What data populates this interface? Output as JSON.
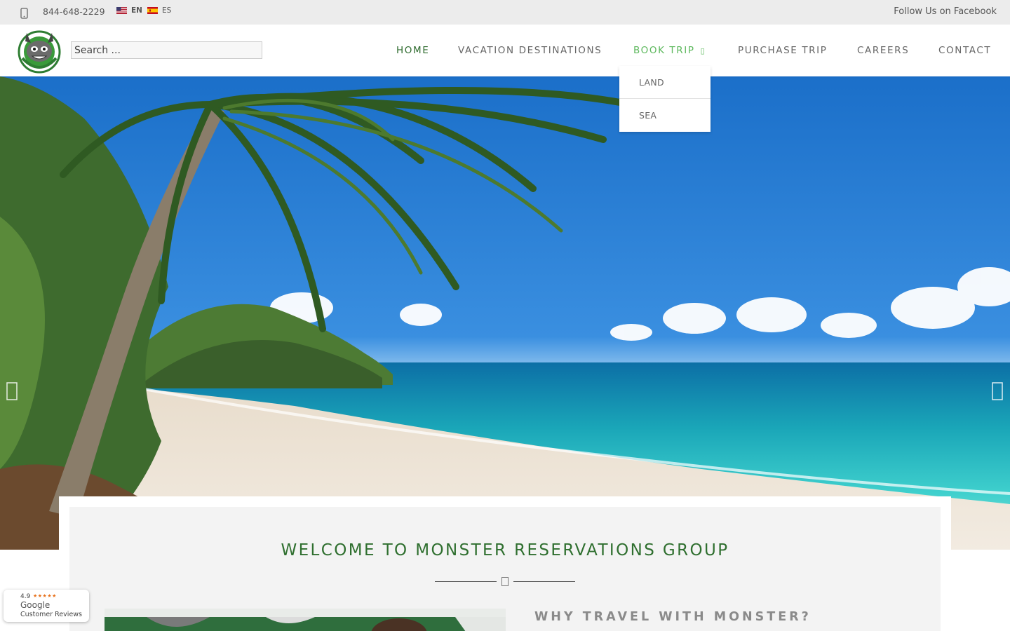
{
  "topbar": {
    "phone": "844-648-2229",
    "lang_en": "EN",
    "lang_es": "ES",
    "follow": "Follow Us on Facebook"
  },
  "header": {
    "search_placeholder": "Search ...",
    "nav": {
      "home": "HOME",
      "vacation": "VACATION DESTINATIONS",
      "book": "BOOK TRIP",
      "purchase": "PURCHASE TRIP",
      "careers": "CAREERS",
      "contact": "CONTACT"
    },
    "dropdown": [
      "LAND",
      "SEA"
    ]
  },
  "welcome": {
    "title": "WELCOME TO MONSTER RESERVATIONS GROUP",
    "why": "WHY TRAVEL WITH MONSTER?"
  },
  "badge": {
    "rating": "4.9",
    "stars": "★★★★★",
    "name": "Google",
    "sub": "Customer Reviews"
  },
  "colors": {
    "brand_green": "#2e6b2e",
    "active_green": "#5cb85c",
    "topbar_bg": "#ececec"
  }
}
